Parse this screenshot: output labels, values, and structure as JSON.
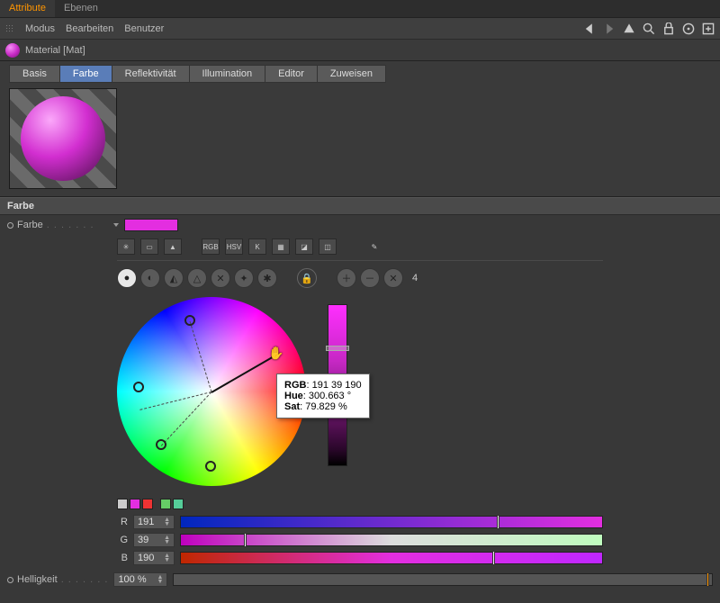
{
  "topTabs": {
    "attribute": "Attribute",
    "ebenen": "Ebenen"
  },
  "menu": {
    "modus": "Modus",
    "bearbeiten": "Bearbeiten",
    "benutzer": "Benutzer"
  },
  "object": {
    "title": "Material [Mat]"
  },
  "attrTabs": {
    "basis": "Basis",
    "farbe": "Farbe",
    "reflekt": "Reflektivität",
    "illum": "Illumination",
    "editor": "Editor",
    "zuweisen": "Zuweisen"
  },
  "section": {
    "farbe": "Farbe"
  },
  "fields": {
    "farbe": "Farbe",
    "helligkeit": "Helligkeit",
    "helligkeitVal": "100 %"
  },
  "mini": {
    "rgb": "RGB",
    "hsv": "HSV"
  },
  "modeCount": "4",
  "tooltip": {
    "rgbLabel": "RGB",
    "rgbVal": "191 39 190",
    "hueLabel": "Hue",
    "hueVal": "300.663 °",
    "satLabel": "Sat",
    "satVal": "79.829 %"
  },
  "channels": {
    "r": {
      "label": "R",
      "val": "191",
      "pct": 75
    },
    "g": {
      "label": "G",
      "val": "39",
      "pct": 15
    },
    "b": {
      "label": "B",
      "val": "190",
      "pct": 74
    }
  },
  "palette": [
    "#ccc",
    "#e32ee0",
    "#e33",
    "#6c6",
    "#5c9"
  ],
  "colors": {
    "accent": "#e32ee0"
  },
  "chart_data": {
    "type": "table",
    "title": "Selected color",
    "series": [
      {
        "name": "R",
        "values": [
          191
        ]
      },
      {
        "name": "G",
        "values": [
          39
        ]
      },
      {
        "name": "B",
        "values": [
          190
        ]
      },
      {
        "name": "Hue",
        "values": [
          300.663
        ]
      },
      {
        "name": "Sat",
        "values": [
          79.829
        ]
      }
    ]
  }
}
